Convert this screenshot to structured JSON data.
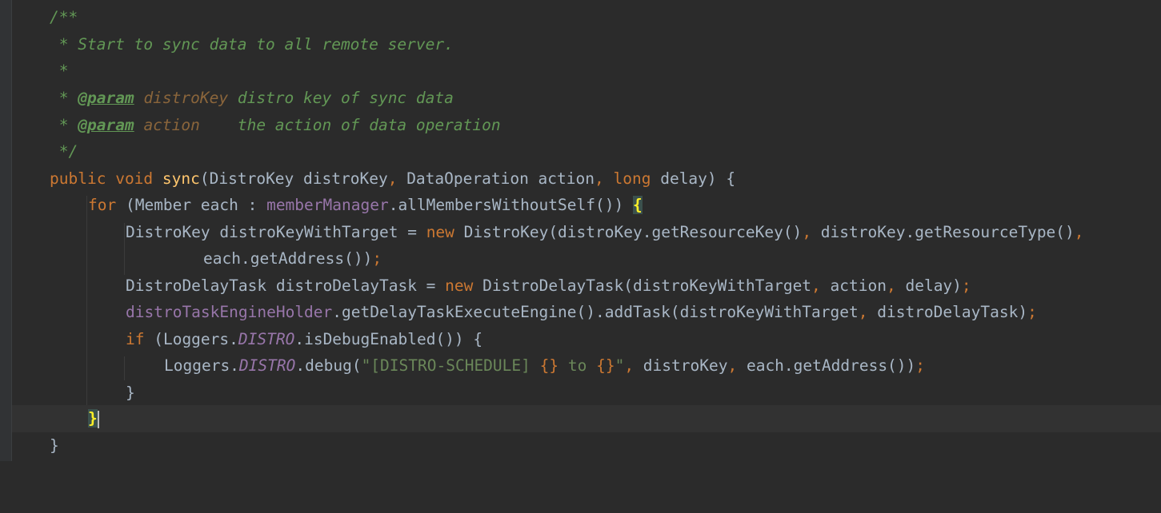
{
  "editor": {
    "comment_open": "/**",
    "comment_desc": " * Start to sync data to all remote server.",
    "comment_blank": " *",
    "comment_star": " * ",
    "param_tag": "@param",
    "param1_name": "distroKey",
    "param1_desc": " distro key of sync data",
    "param2_name": "action",
    "param2_desc": "    the action of data operation",
    "comment_close": " */",
    "kw_public": "public",
    "kw_void": "void",
    "method_name": "sync",
    "sig_params_a": "(DistroKey distroKey",
    "comma": ",",
    "sig_params_b": " DataOperation action",
    "kw_long": "long",
    "sig_params_c": " delay) {",
    "kw_for": "for",
    "for_head": " (Member each : ",
    "field_memberManager": "memberManager",
    "for_call": ".allMembersWithoutSelf()) ",
    "brace_open": "{",
    "l1_a": "DistroKey distroKeyWithTarget = ",
    "kw_new": "new",
    "l1_b": " DistroKey(distroKey.getResourceKey()",
    "l1_c": " distroKey.getResourceType()",
    "l2_a": "each.getAddress())",
    "semicolon": ";",
    "l3_a": "DistroDelayTask distroDelayTask = ",
    "l3_b": " DistroDelayTask(distroKeyWithTarget",
    "l3_c": " action",
    "l3_d": " delay)",
    "field_holder": "distroTaskEngineHolder",
    "l4_a": ".getDelayTaskExecuteEngine().addTask(distroKeyWithTarget",
    "l4_b": " distroDelayTask)",
    "kw_if": "if",
    "l5_a": " (Loggers.",
    "static_distro": "DISTRO",
    "l5_b": ".isDebugEnabled()) {",
    "l6_a": "Loggers.",
    "l6_b": ".debug(",
    "str_open": "\"[DISTRO-SCHEDULE] ",
    "fmt1": "{}",
    "str_mid": " to ",
    "fmt2": "{}",
    "str_close": "\"",
    "l6_c": " distroKey",
    "l6_d": " each.getAddress())",
    "brace_close": "}"
  }
}
